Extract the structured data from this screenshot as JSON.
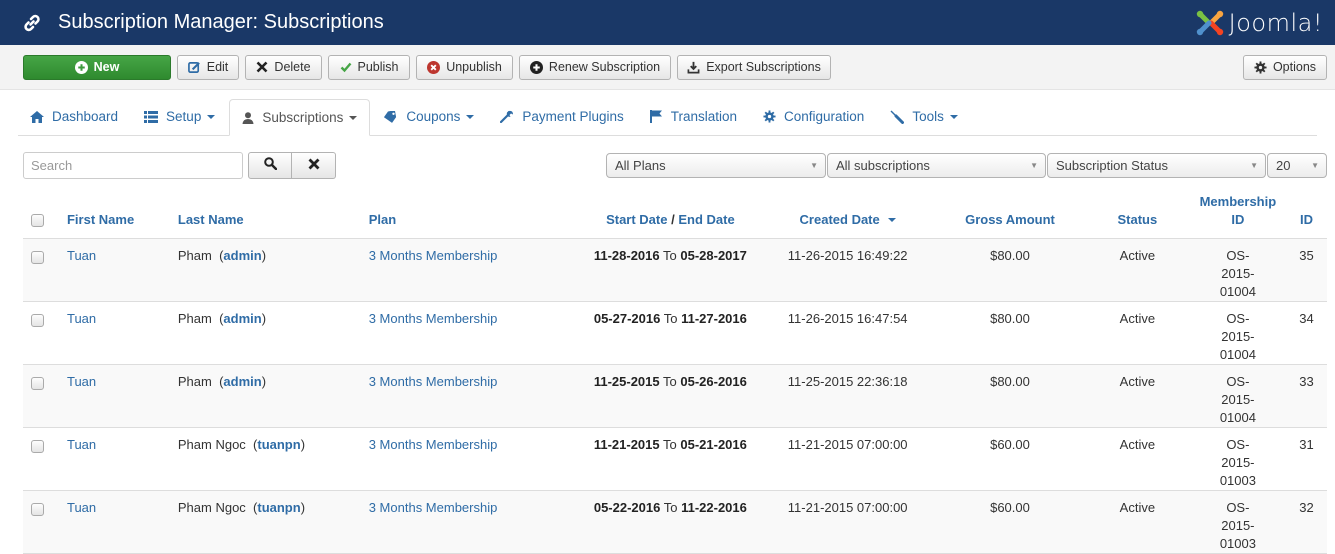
{
  "header": {
    "title": "Subscription Manager: Subscriptions",
    "brand": "Joomla!"
  },
  "toolbar": {
    "new_label": "New",
    "edit_label": "Edit",
    "delete_label": "Delete",
    "publish_label": "Publish",
    "unpublish_label": "Unpublish",
    "renew_label": "Renew Subscription",
    "export_label": "Export Subscriptions",
    "options_label": "Options"
  },
  "tabs": [
    {
      "label": "Dashboard",
      "icon": "home-icon"
    },
    {
      "label": "Setup",
      "icon": "list-icon",
      "dropdown": true
    },
    {
      "label": "Subscriptions",
      "icon": "user-icon",
      "dropdown": true,
      "active": true
    },
    {
      "label": "Coupons",
      "icon": "tag-icon",
      "dropdown": true
    },
    {
      "label": "Payment Plugins",
      "icon": "wrench-icon"
    },
    {
      "label": "Translation",
      "icon": "flag-icon"
    },
    {
      "label": "Configuration",
      "icon": "gear-icon"
    },
    {
      "label": "Tools",
      "icon": "screwdriver-icon",
      "dropdown": true
    }
  ],
  "filters": {
    "search_placeholder": "Search",
    "search_value": "",
    "plan_select": "All Plans",
    "subscription_select": "All subscriptions",
    "status_select": "Subscription Status",
    "limit_select": "20"
  },
  "table": {
    "columns": {
      "first_name": "First Name",
      "last_name": "Last Name",
      "plan": "Plan",
      "start_date": "Start Date",
      "date_sep": " / ",
      "end_date": "End Date",
      "created_date": "Created Date",
      "gross_amount": "Gross Amount",
      "status": "Status",
      "membership_id": "Membership ID",
      "id": "ID"
    },
    "date_joiner": "To",
    "rows": [
      {
        "first_name": "Tuan",
        "last_name": "Pham",
        "username": "admin",
        "plan": "3 Months Membership",
        "start": "11-28-2016",
        "end": "05-28-2017",
        "created": "11-26-2015 16:49:22",
        "amount": "$80.00",
        "status": "Active",
        "membership_id": "OS-2015-01004",
        "id": "35"
      },
      {
        "first_name": "Tuan",
        "last_name": "Pham",
        "username": "admin",
        "plan": "3 Months Membership",
        "start": "05-27-2016",
        "end": "11-27-2016",
        "created": "11-26-2015 16:47:54",
        "amount": "$80.00",
        "status": "Active",
        "membership_id": "OS-2015-01004",
        "id": "34"
      },
      {
        "first_name": "Tuan",
        "last_name": "Pham",
        "username": "admin",
        "plan": "3 Months Membership",
        "start": "11-25-2015",
        "end": "05-26-2016",
        "created": "11-25-2015 22:36:18",
        "amount": "$80.00",
        "status": "Active",
        "membership_id": "OS-2015-01004",
        "id": "33"
      },
      {
        "first_name": "Tuan",
        "last_name": "Pham Ngoc",
        "username": "tuanpn",
        "plan": "3 Months Membership",
        "start": "11-21-2015",
        "end": "05-21-2016",
        "created": "11-21-2015 07:00:00",
        "amount": "$60.00",
        "status": "Active",
        "membership_id": "OS-2015-01003",
        "id": "31"
      },
      {
        "first_name": "Tuan",
        "last_name": "Pham Ngoc",
        "username": "tuanpn",
        "plan": "3 Months Membership",
        "start": "05-22-2016",
        "end": "11-22-2016",
        "created": "11-21-2015 07:00:00",
        "amount": "$60.00",
        "status": "Active",
        "membership_id": "OS-2015-01003",
        "id": "32"
      }
    ]
  },
  "colors": {
    "header_bg": "#1a3867",
    "link": "#2f6ca6",
    "new_button": "#3d9a3d",
    "unpublish_icon": "#bd362f"
  }
}
